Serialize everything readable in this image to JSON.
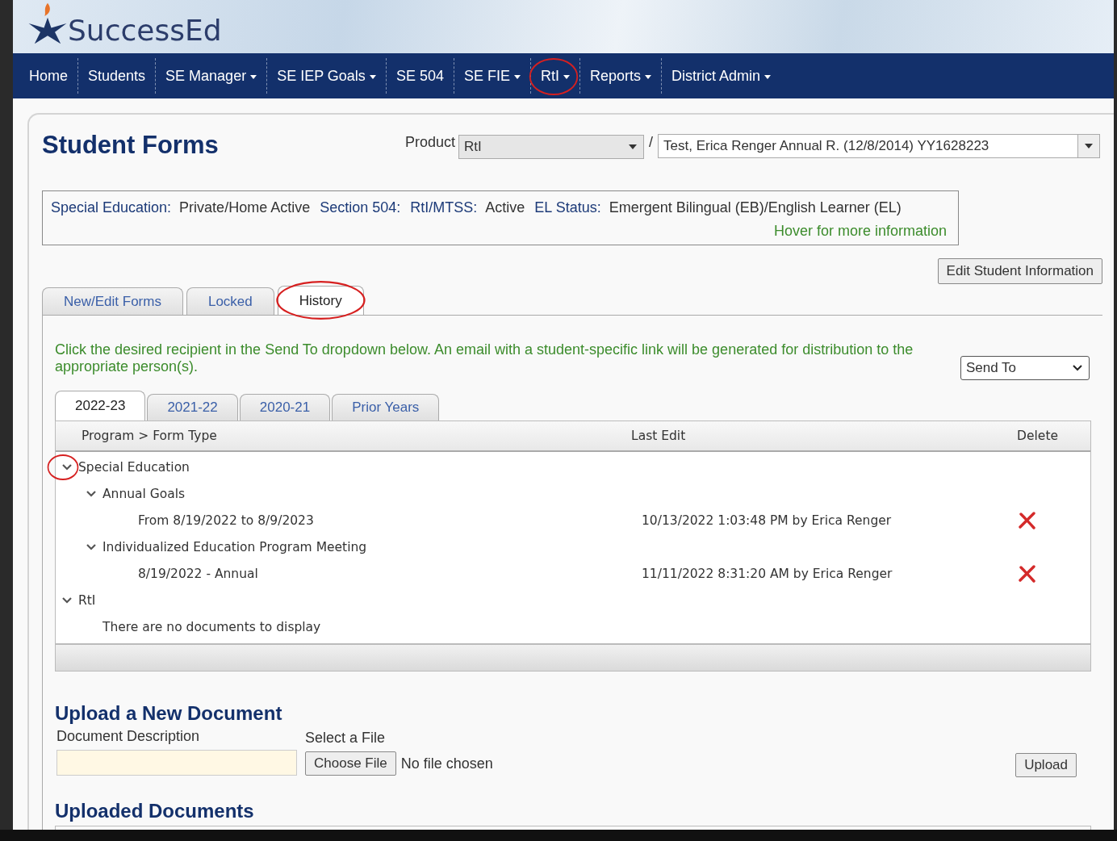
{
  "logo": {
    "text": "SuccessEd"
  },
  "nav": [
    {
      "label": "Home",
      "dropdown": false,
      "circled": false
    },
    {
      "label": "Students",
      "dropdown": false,
      "circled": false
    },
    {
      "label": "SE Manager",
      "dropdown": true,
      "circled": false
    },
    {
      "label": "SE IEP Goals",
      "dropdown": true,
      "circled": false
    },
    {
      "label": "SE 504",
      "dropdown": false,
      "circled": false
    },
    {
      "label": "SE FIE",
      "dropdown": true,
      "circled": false
    },
    {
      "label": "RtI",
      "dropdown": true,
      "circled": true
    },
    {
      "label": "Reports",
      "dropdown": true,
      "circled": false
    },
    {
      "label": "District Admin",
      "dropdown": true,
      "circled": false
    }
  ],
  "page_title": "Student Forms",
  "product": {
    "label": "Product",
    "value": "RtI",
    "separator": "/",
    "student": "Test, Erica Renger Annual R.  (12/8/2014)  YY1628223"
  },
  "status_info": {
    "fields": [
      {
        "label": "Special Education:",
        "value": "Private/Home Active"
      },
      {
        "label": "Section 504:"
      },
      {
        "label": "RtI/MTSS:",
        "value": "Active"
      },
      {
        "label": "EL Status:",
        "value": "Emergent Bilingual (EB)/English Learner (EL)"
      }
    ],
    "hover_hint": "Hover for more information"
  },
  "edit_button": "Edit Student Information",
  "tabs": [
    {
      "label": "New/Edit Forms",
      "selected": false,
      "circled": false
    },
    {
      "label": "Locked",
      "selected": false,
      "circled": false
    },
    {
      "label": "History",
      "selected": true,
      "circled": true
    }
  ],
  "instructions": "Click the desired recipient in the Send To dropdown below. An email with a student-specific link will be generated for distribution to the appropriate person(s).",
  "send_to": {
    "value": "Send To"
  },
  "year_tabs": [
    {
      "label": "2022-23",
      "selected": true
    },
    {
      "label": "2021-22",
      "selected": false
    },
    {
      "label": "2020-21",
      "selected": false
    },
    {
      "label": "Prior Years",
      "selected": false
    }
  ],
  "table": {
    "columns": [
      "Program > Form Type",
      "Last Edit",
      "Delete"
    ],
    "rows": [
      {
        "kind": "group",
        "label": "Special Education",
        "expanded": true,
        "circled": true,
        "children": [
          {
            "kind": "group",
            "label": "Annual Goals",
            "expanded": true,
            "circled": false,
            "children": [
              {
                "kind": "form",
                "label": "From 8/19/2022 to 8/9/2023",
                "last_edit": "10/13/2022 1:03:48 PM by Erica Renger"
              }
            ]
          },
          {
            "kind": "group",
            "label": "Individualized Education Program Meeting",
            "expanded": true,
            "circled": false,
            "children": [
              {
                "kind": "form",
                "label": "8/19/2022 - Annual",
                "last_edit": "11/11/2022 8:31:20 AM by Erica Renger"
              }
            ]
          }
        ]
      },
      {
        "kind": "group",
        "label": "RtI",
        "expanded": true,
        "circled": false,
        "children": [
          {
            "kind": "empty",
            "label": "There are no documents to display"
          }
        ]
      }
    ]
  },
  "upload": {
    "title": "Upload a New Document",
    "description_label": "Document Description",
    "file_label": "Select a File",
    "choose_button": "Choose File",
    "file_status": "No file chosen",
    "upload_button": "Upload"
  },
  "uploaded_title": "Uploaded Documents"
}
